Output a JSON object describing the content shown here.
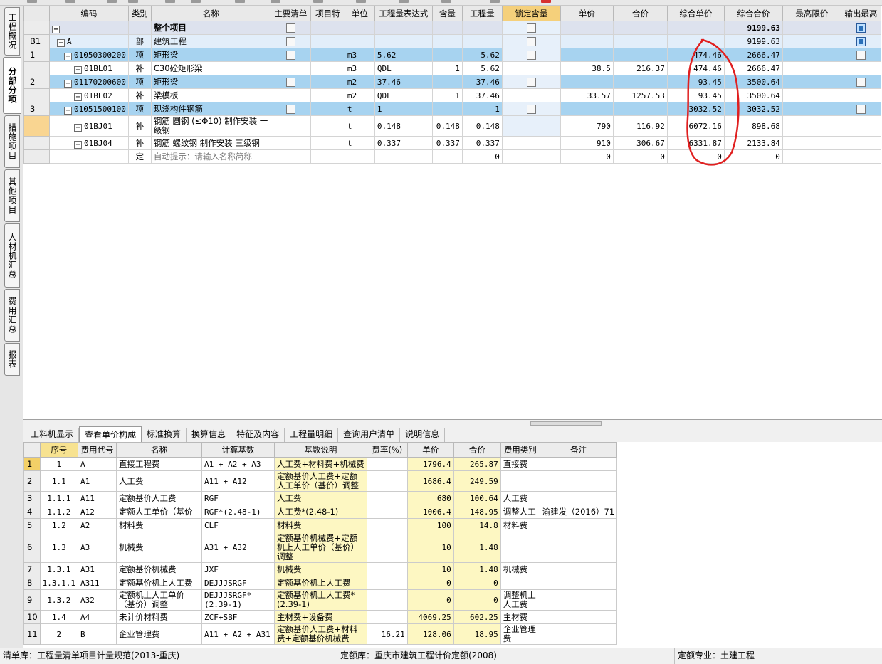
{
  "side_tabs": [
    {
      "label": "工程概况",
      "active": false
    },
    {
      "label": "分部分项",
      "active": true
    },
    {
      "label": "措施项目",
      "active": false
    },
    {
      "label": "其他项目",
      "active": false
    },
    {
      "label": "人材机汇总",
      "active": false
    },
    {
      "label": "费用汇总",
      "active": false
    },
    {
      "label": "报表",
      "active": false
    }
  ],
  "main_grid": {
    "headers": [
      "编码",
      "类别",
      "名称",
      "主要清单",
      "项目特",
      "单位",
      "工程量表达式",
      "含量",
      "工程量",
      "锁定含量",
      "单价",
      "合价",
      "综合单价",
      "综合合价",
      "最高限价",
      "输出最高"
    ],
    "rows": [
      {
        "rn": "",
        "code": "",
        "type": "",
        "name": "整个项目",
        "unit": "",
        "expr": "",
        "content": "",
        "qty": "",
        "price": "",
        "total": "",
        "comp_price": "",
        "comp_total": "9199.63"
      },
      {
        "rn": "B1",
        "code": "A",
        "type": "部",
        "name": "建筑工程",
        "unit": "",
        "expr": "",
        "content": "",
        "qty": "",
        "price": "",
        "total": "",
        "comp_price": "",
        "comp_total": "9199.63"
      },
      {
        "rn": "1",
        "code": "01050300200",
        "type": "项",
        "name": "矩形梁",
        "unit": "m3",
        "expr": "5.62",
        "content": "",
        "qty": "5.62",
        "price": "",
        "total": "",
        "comp_price": "474.46",
        "comp_total": "2666.47"
      },
      {
        "rn": "",
        "code": "01BL01",
        "type": "补",
        "name": "C30砼矩形梁",
        "unit": "m3",
        "expr": "QDL",
        "content": "1",
        "qty": "5.62",
        "price": "38.5",
        "total": "216.37",
        "comp_price": "474.46",
        "comp_total": "2666.47"
      },
      {
        "rn": "2",
        "code": "01170200600",
        "type": "项",
        "name": "矩形梁",
        "unit": "m2",
        "expr": "37.46",
        "content": "",
        "qty": "37.46",
        "price": "",
        "total": "",
        "comp_price": "93.45",
        "comp_total": "3500.64"
      },
      {
        "rn": "",
        "code": "01BL02",
        "type": "补",
        "name": "梁模板",
        "unit": "m2",
        "expr": "QDL",
        "content": "1",
        "qty": "37.46",
        "price": "33.57",
        "total": "1257.53",
        "comp_price": "93.45",
        "comp_total": "3500.64"
      },
      {
        "rn": "3",
        "code": "01051500100",
        "type": "项",
        "name": "现浇构件钢筋",
        "unit": "t",
        "expr": "1",
        "content": "",
        "qty": "1",
        "price": "",
        "total": "",
        "comp_price": "3032.52",
        "comp_total": "3032.52"
      },
      {
        "rn": "",
        "code": "01BJ01",
        "type": "补",
        "name": "钢筋 圆钢 (≤Φ10) 制作安装 一级钢",
        "unit": "t",
        "expr": "0.148",
        "content": "0.148",
        "qty": "0.148",
        "price": "790",
        "total": "116.92",
        "comp_price": "6072.16",
        "comp_total": "898.68"
      },
      {
        "rn": "",
        "code": "01BJ04",
        "type": "补",
        "name": "钢筋 螺纹钢 制作安装 三级钢",
        "unit": "t",
        "expr": "0.337",
        "content": "0.337",
        "qty": "0.337",
        "price": "910",
        "total": "306.67",
        "comp_price": "6331.87",
        "comp_total": "2133.84"
      },
      {
        "rn": "",
        "code": "",
        "type": "定",
        "name": "自动提示：请输入名称简称",
        "unit": "",
        "expr": "",
        "content": "",
        "qty": "0",
        "price": "0",
        "total": "0",
        "comp_price": "0",
        "comp_total": "0"
      }
    ]
  },
  "bottom_tabs": [
    {
      "label": "工料机显示",
      "active": false
    },
    {
      "label": "查看单价构成",
      "active": true
    },
    {
      "label": "标准换算",
      "active": false
    },
    {
      "label": "换算信息",
      "active": false
    },
    {
      "label": "特征及内容",
      "active": false
    },
    {
      "label": "工程量明细",
      "active": false
    },
    {
      "label": "查询用户清单",
      "active": false
    },
    {
      "label": "说明信息",
      "active": false
    }
  ],
  "fee_grid": {
    "headers": [
      "序号",
      "费用代号",
      "名称",
      "计算基数",
      "基数说明",
      "费率(%)",
      "单价",
      "合价",
      "费用类别",
      "备注"
    ],
    "rows": [
      {
        "rn": "1",
        "seq": "1",
        "code": "A",
        "name": "直接工程费",
        "base": "A1 + A2 + A3",
        "desc": "人工费+材料费+机械费",
        "rate": "",
        "price": "1796.4",
        "total": "265.87",
        "cat": "直接费",
        "note": ""
      },
      {
        "rn": "2",
        "seq": "1.1",
        "code": "A1",
        "name": "人工费",
        "base": "A11 + A12",
        "desc": "定额基价人工费+定额人工单价（基价）调整",
        "rate": "",
        "price": "1686.4",
        "total": "249.59",
        "cat": "",
        "note": ""
      },
      {
        "rn": "3",
        "seq": "1.1.1",
        "code": "A11",
        "name": "定额基价人工费",
        "base": "RGF",
        "desc": "人工费",
        "rate": "",
        "price": "680",
        "total": "100.64",
        "cat": "人工费",
        "note": ""
      },
      {
        "rn": "4",
        "seq": "1.1.2",
        "code": "A12",
        "name": "定额人工单价（基价",
        "base": "RGF*(2.48-1)",
        "desc": "人工费*(2.48-1)",
        "rate": "",
        "price": "1006.4",
        "total": "148.95",
        "cat": "调整人工",
        "note": "渝建发（2016）71"
      },
      {
        "rn": "5",
        "seq": "1.2",
        "code": "A2",
        "name": "材料费",
        "base": "CLF",
        "desc": "材料费",
        "rate": "",
        "price": "100",
        "total": "14.8",
        "cat": "材料费",
        "note": ""
      },
      {
        "rn": "6",
        "seq": "1.3",
        "code": "A3",
        "name": "机械费",
        "base": "A31 + A32",
        "desc": "定额基价机械费+定额机上人工单价（基价）调整",
        "rate": "",
        "price": "10",
        "total": "1.48",
        "cat": "",
        "note": ""
      },
      {
        "rn": "7",
        "seq": "1.3.1",
        "code": "A31",
        "name": "定额基价机械费",
        "base": "JXF",
        "desc": "机械费",
        "rate": "",
        "price": "10",
        "total": "1.48",
        "cat": "机械费",
        "note": ""
      },
      {
        "rn": "8",
        "seq": "1.3.1.1",
        "code": "A311",
        "name": "定额基价机上人工费",
        "base": "DEJJJSRGF",
        "desc": "定额基价机上人工费",
        "rate": "",
        "price": "0",
        "total": "0",
        "cat": "",
        "note": ""
      },
      {
        "rn": "9",
        "seq": "1.3.2",
        "code": "A32",
        "name": "定额机上人工单价（基价）调整",
        "base": "DEJJJSRGF*(2.39-1)",
        "desc": "定额基价机上人工费*(2.39-1)",
        "rate": "",
        "price": "0",
        "total": "0",
        "cat": "调整机上人工费",
        "note": ""
      },
      {
        "rn": "10",
        "seq": "1.4",
        "code": "A4",
        "name": "未计价材料费",
        "base": "ZCF+SBF",
        "desc": "主材费+设备费",
        "rate": "",
        "price": "4069.25",
        "total": "602.25",
        "cat": "主材费",
        "note": ""
      },
      {
        "rn": "11",
        "seq": "2",
        "code": "B",
        "name": "企业管理费",
        "base": "A11 + A2 + A31",
        "desc": "定额基价人工费+材料费+定额基价机械费",
        "rate": "16.21",
        "price": "128.06",
        "total": "18.95",
        "cat": "企业管理费",
        "note": ""
      }
    ]
  },
  "status_bar": {
    "list_lib": "清单库：工程量清单项目计量规范(2013-重庆)",
    "quota_lib": "定额库：重庆市建筑工程计价定额(2008)",
    "discipline": "定额专业：土建工程"
  },
  "colors": {
    "item_row": "#a7d3f0",
    "part_row": "#e2eefa",
    "total_row": "#dde2ee",
    "lock_header": "#f5d07b",
    "fee_yellow": "#fdf7c2",
    "annotation_red": "#e02020"
  }
}
